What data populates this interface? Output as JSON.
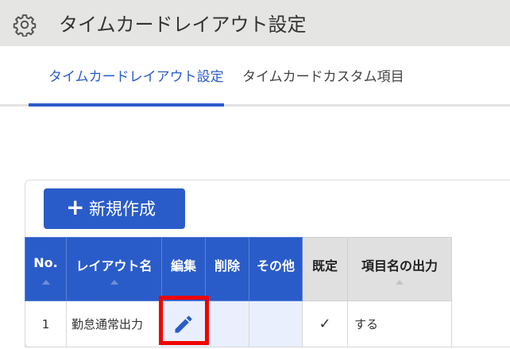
{
  "header": {
    "title": "タイムカードレイアウト設定",
    "icon": "gear-icon"
  },
  "tabs": [
    {
      "label": "タイムカードレイアウト設定",
      "active": true
    },
    {
      "label": "タイムカードカスタム項目",
      "active": false
    }
  ],
  "toolbar": {
    "new_label": "新規作成",
    "new_icon": "plus-icon"
  },
  "table": {
    "columns": [
      "No.",
      "レイアウト名",
      "編集",
      "削除",
      "その他",
      "既定",
      "項目名の出力"
    ],
    "rows": [
      {
        "no": "1",
        "name": "勤怠通常出力",
        "edit_icon": "pencil-icon",
        "default": "✓",
        "output": "する"
      }
    ]
  },
  "colors": {
    "accent": "#2a5cc9",
    "header_bg": "#e5e5e3",
    "highlight": "#f00000"
  }
}
